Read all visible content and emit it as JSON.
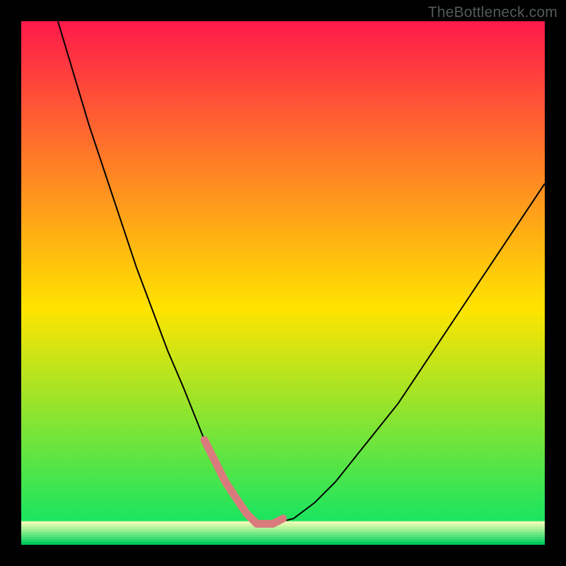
{
  "watermark": "TheBottleneck.com",
  "chart_data": {
    "type": "line",
    "title": "",
    "xlabel": "",
    "ylabel": "",
    "xlim": [
      0,
      100
    ],
    "ylim": [
      0,
      100
    ],
    "background_gradient": {
      "top_color": "#ff1a4b",
      "mid_color": "#ffe400",
      "bottom_color": "#00e56a"
    },
    "series": [
      {
        "name": "curve",
        "stroke": "#000000",
        "stroke_width": 2,
        "x": [
          7,
          10,
          13,
          16,
          19,
          22,
          25,
          28,
          31,
          33,
          35,
          37,
          39,
          41,
          43,
          45,
          48,
          52,
          56,
          60,
          64,
          68,
          72,
          76,
          80,
          84,
          88,
          92,
          96,
          100
        ],
        "y": [
          100,
          90,
          80,
          71,
          62,
          53,
          45,
          37,
          30,
          25,
          20,
          16,
          12,
          9,
          6,
          4,
          4,
          5,
          8,
          12,
          17,
          22,
          27,
          33,
          39,
          45,
          51,
          57,
          63,
          69
        ]
      },
      {
        "name": "highlight",
        "stroke": "#d97b7d",
        "stroke_width": 11,
        "linecap": "round",
        "x": [
          35,
          37,
          39,
          41,
          43,
          45,
          48,
          50
        ],
        "y": [
          20,
          16,
          12,
          9,
          6,
          4,
          4,
          5
        ]
      }
    ],
    "bottom_stripes": {
      "count": 9,
      "y_start": 0,
      "y_end": 4.5,
      "colors": [
        "#00c95c",
        "#1fd468",
        "#3cdc72",
        "#5be37c",
        "#7aea86",
        "#98ef91",
        "#b6f49c",
        "#d3f7a8",
        "#effab5"
      ]
    }
  }
}
